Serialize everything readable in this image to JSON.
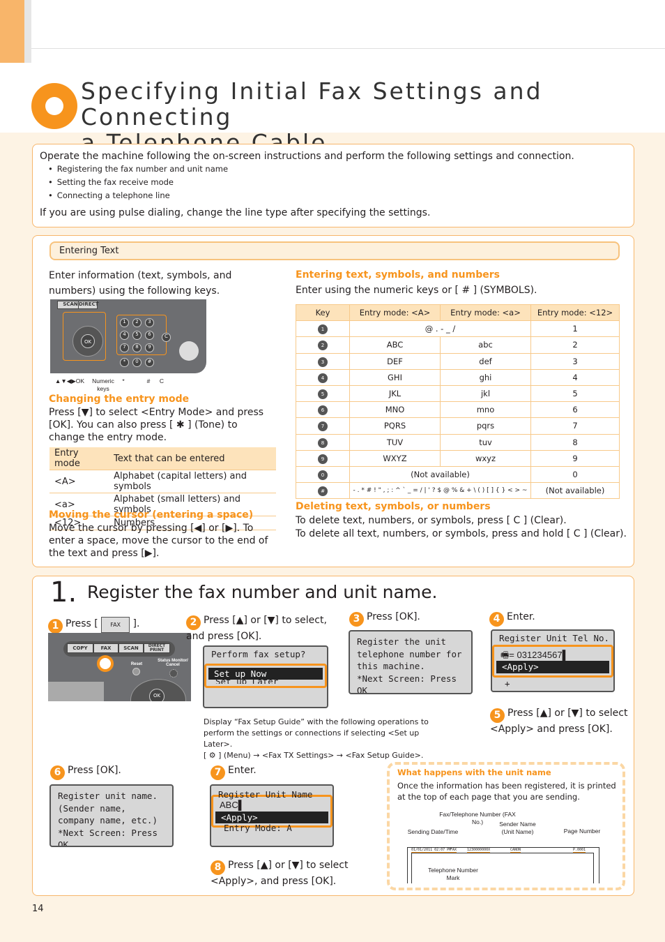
{
  "title": {
    "line1": "Specifying Initial Fax Settings and Connecting",
    "line2": "a Telephone Cable"
  },
  "intro": {
    "text": "Operate the machine following the on-screen instructions and perform the following settings and connection.",
    "bullets": [
      "Registering the fax number and unit name",
      "Setting the fax receive mode",
      "Connecting a telephone line"
    ],
    "note": "If you are using pulse dialing, change the line type after specifying the settings."
  },
  "entering": {
    "heading": "Entering Text",
    "intro": "Enter information (text, symbols, and numbers) using the following keys.",
    "panel_labels": {
      "arrows_ok": "▲▼◀▶OK",
      "numeric": "Numeric keys",
      "star": "*",
      "hash": "#",
      "clear": "C"
    },
    "changing_title": "Changing the entry mode",
    "changing_text": "Press [▼] to select <Entry Mode> and press [OK]. You can also press [ ✱ ] (Tone) to change the entry mode.",
    "mode_table": {
      "headers": [
        "Entry mode",
        "Text that can be entered"
      ],
      "rows": [
        [
          "<A>",
          "Alphabet (capital letters) and symbols"
        ],
        [
          "<a>",
          "Alphabet (small letters) and symbols"
        ],
        [
          "<12>",
          "Numbers"
        ]
      ]
    },
    "moving_title": "Moving the cursor (entering a space)",
    "moving_text": "Move the cursor by pressing [◀] or [▶]. To enter a space, move the cursor to the end of the text and press [▶].",
    "entering_title": "Entering text, symbols, and numbers",
    "entering_text": "Enter using the numeric keys or [ # ] (SYMBOLS).",
    "key_table": {
      "headers": [
        "Key",
        "Entry mode: <A>",
        "Entry mode: <a>",
        "Entry mode: <12>"
      ],
      "rows": [
        {
          "key": "1",
          "A": "@ . - _ /",
          "a": null,
          "n": "1"
        },
        {
          "key": "2",
          "A": "ABC",
          "a": "abc",
          "n": "2"
        },
        {
          "key": "3",
          "A": "DEF",
          "a": "def",
          "n": "3"
        },
        {
          "key": "4",
          "A": "GHI",
          "a": "ghi",
          "n": "4"
        },
        {
          "key": "5",
          "A": "JKL",
          "a": "jkl",
          "n": "5"
        },
        {
          "key": "6",
          "A": "MNO",
          "a": "mno",
          "n": "6"
        },
        {
          "key": "7",
          "A": "PQRS",
          "a": "pqrs",
          "n": "7"
        },
        {
          "key": "8",
          "A": "TUV",
          "a": "tuv",
          "n": "8"
        },
        {
          "key": "9",
          "A": "WXYZ",
          "a": "wxyz",
          "n": "9"
        },
        {
          "key": "0",
          "A": "(Not available)",
          "a": null,
          "n": "0"
        },
        {
          "key": "#",
          "A": "- . * # ! \" , ; : ^ ` _ = / | ' ? $ @ % & + \\ ( ) [ ] { } < > ~",
          "a": null,
          "n": "(Not available)"
        }
      ]
    },
    "deleting_title": "Deleting text, symbols, or numbers",
    "deleting_1": "To delete text, numbers, or symbols, press [ C ] (Clear).",
    "deleting_2": "To delete all text, numbers, or symbols, press and hold [ C ] (Clear)."
  },
  "step": {
    "number": "1.",
    "title": "Register the fax number and unit name.",
    "s1": {
      "n": "1",
      "pre": "Press [",
      "key": "FAX",
      "post": "]."
    },
    "panel": {
      "copy": "COPY",
      "fax": "FAX",
      "scan": "SCAN",
      "direct": "DIRECT PRINT",
      "reset": "Reset",
      "status": "Status Monitor/ Cancel",
      "ok": "OK"
    },
    "s2": {
      "n": "2",
      "text": "Press [▲] or [▼] to select, and press [OK].",
      "lcd": [
        "Perform fax setup?",
        "Set up Now",
        "Set up Later"
      ],
      "note": "Display “Fax Setup Guide” with the following operations to perform the settings or connections if selecting <Set up Later>.",
      "note2": "[ ⚙ ] (Menu) → <Fax TX Settings> → <Fax Setup Guide>."
    },
    "s3": {
      "n": "3",
      "text": "Press [OK].",
      "lcd": [
        "Register the unit",
        "telephone number for",
        "this machine.",
        "*Next Screen: Press OK"
      ]
    },
    "s4": {
      "n": "4",
      "text": "Enter.",
      "lcd": [
        "Register Unit Tel No.",
        "= 031234567",
        "<Apply>",
        "+"
      ]
    },
    "s5": {
      "n": "5",
      "text": "Press [▲] or [▼] to select <Apply> and press [OK]."
    },
    "s6": {
      "n": "6",
      "text": "Press [OK].",
      "lcd": [
        "Register unit name.",
        "(Sender name,",
        "company name, etc.)",
        "*Next Screen: Press OK"
      ]
    },
    "s7": {
      "n": "7",
      "text": "Enter.",
      "lcd": [
        "Register Unit Name",
        "ABC",
        "<Apply>",
        "Entry Mode: A"
      ]
    },
    "s8": {
      "n": "8",
      "text": "Press [▲] or [▼] to select <Apply>, and press [OK]."
    },
    "info": {
      "title": "What happens with the unit name",
      "text": "Once the information has been registered, it is printed at the top of each page that you are sending.",
      "labels": {
        "fax_no": "Fax/Telephone Number (FAX No.)",
        "sender": "Sender Name (Unit Name)",
        "date": "Sending Date/Time",
        "page": "Page Number",
        "tel_mark": "Telephone Number Mark"
      },
      "sample": {
        "date": "01/01/2011 02:07 PM",
        "mark": "FAX",
        "number": "1230000000X",
        "name": "CANON",
        "page": "P.0001"
      }
    }
  },
  "page_number": "14",
  "colors": {
    "accent": "#f7941d",
    "light": "#fde3bb",
    "background": "#fdf3e4"
  }
}
